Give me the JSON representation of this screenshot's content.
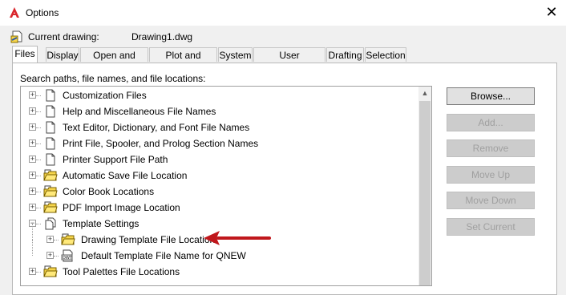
{
  "window": {
    "title": "Options",
    "close_glyph": "✕"
  },
  "current_drawing": {
    "label": "Current drawing:",
    "value": "Drawing1.dwg"
  },
  "tabs": [
    {
      "label": "Files",
      "active": true
    },
    {
      "label": "Display"
    },
    {
      "label": "Open and Save"
    },
    {
      "label": "Plot and Publish"
    },
    {
      "label": "System"
    },
    {
      "label": "User Preferences"
    },
    {
      "label": "Drafting"
    },
    {
      "label": "Selection"
    }
  ],
  "panel": {
    "label": "Search paths, file names, and file locations:"
  },
  "tree": {
    "items": [
      {
        "label": "Customization Files",
        "icon": "file-icon",
        "expander": "+"
      },
      {
        "label": "Help and Miscellaneous File Names",
        "icon": "file-icon",
        "expander": "+"
      },
      {
        "label": "Text Editor, Dictionary, and Font File Names",
        "icon": "file-icon",
        "expander": "+"
      },
      {
        "label": "Print File, Spooler, and Prolog Section Names",
        "icon": "file-icon",
        "expander": "+"
      },
      {
        "label": "Printer Support File Path",
        "icon": "file-icon",
        "expander": "+"
      },
      {
        "label": "Automatic Save File Location",
        "icon": "folder-icon",
        "expander": "+"
      },
      {
        "label": "Color Book Locations",
        "icon": "folder-icon",
        "expander": "+"
      },
      {
        "label": "PDF Import Image Location",
        "icon": "folder-icon",
        "expander": "+"
      },
      {
        "label": "Template Settings",
        "icon": "files-icon",
        "expander": "−"
      },
      {
        "label": "Drawing Template File Location",
        "icon": "folder-icon",
        "expander": "+",
        "child": true
      },
      {
        "label": "Default Template File Name for QNEW",
        "icon": "dwt-icon",
        "expander": "+",
        "child": true
      },
      {
        "label": "Tool Palettes File Locations",
        "icon": "folder-icon",
        "expander": "+"
      }
    ]
  },
  "buttons": {
    "browse": "Browse...",
    "add": "Add...",
    "remove": "Remove",
    "move_up": "Move Up",
    "move_down": "Move Down",
    "set_current": "Set Current"
  },
  "colors": {
    "annotation_arrow": "#c0171c",
    "folder_yellow": "#f7d64b",
    "app_icon_red": "#d9262c"
  }
}
